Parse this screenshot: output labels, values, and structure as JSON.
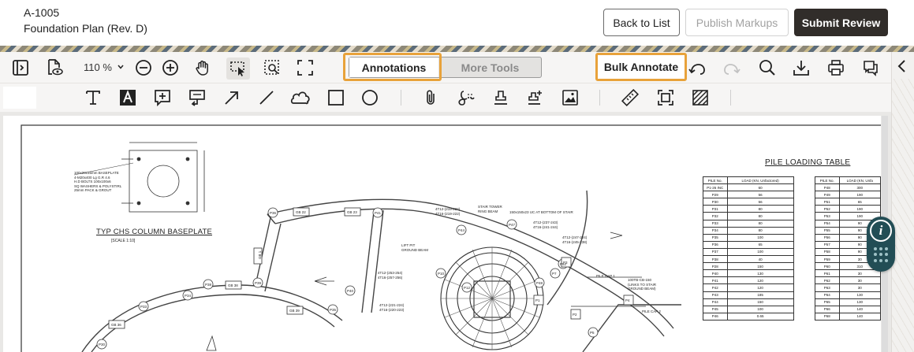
{
  "header": {
    "doc_id": "A-1005",
    "doc_title": "Foundation Plan (Rev. D)",
    "back_label": "Back to List",
    "publish_label": "Publish Markups",
    "submit_label": "Submit Review"
  },
  "toolbar": {
    "zoom": "110 %",
    "tab_annotations": "Annotations",
    "tab_more_tools": "More Tools",
    "bulk_annotate": "Bulk Annotate",
    "icons_row1": [
      "sidebar-toggle-icon",
      "document-eye-icon",
      "zoom-dropdown-chevron-icon",
      "zoom-out-icon",
      "zoom-in-icon",
      "pan-hand-icon",
      "select-area-icon",
      "zoom-area-icon",
      "fullscreen-icon",
      "undo-icon",
      "redo-icon",
      "search-icon",
      "download-icon",
      "print-icon",
      "comments-icon",
      "collapse-panel-icon"
    ],
    "icons_row2": [
      "text-icon",
      "text-box-icon",
      "note-icon",
      "callout-icon",
      "arrow-icon",
      "line-icon",
      "cloud-icon",
      "rectangle-icon",
      "ellipse-icon",
      "attachment-icon",
      "signature-icon",
      "stamp-icon",
      "custom-stamp-icon",
      "image-icon",
      "measure-icon",
      "crop-icon",
      "hatch-icon"
    ]
  },
  "drawing": {
    "plan_title": "TYP CHS COLUMN BASEPLATE",
    "plan_scale": "[SCALE 1:10]",
    "table_title": "PILE LOADING TABLE",
    "table_header": [
      "PILE No.",
      "LOAD (KN, Unfactored)",
      "PILE No.",
      "LOAD (KN, Unfa"
    ],
    "table_rows": [
      [
        "P1-26 INC",
        "60",
        "P48",
        "300"
      ],
      [
        "P29",
        "56",
        "P49",
        "190"
      ],
      [
        "P30",
        "56",
        "P51",
        "65"
      ],
      [
        "P31",
        "80",
        "P52",
        "190"
      ],
      [
        "P32",
        "80",
        "P53",
        "190"
      ],
      [
        "P33",
        "80",
        "P54",
        "90"
      ],
      [
        "P34",
        "80",
        "P55",
        "90"
      ],
      [
        "P35",
        "100",
        "P56",
        "90"
      ],
      [
        "P36",
        "65",
        "P57",
        "90"
      ],
      [
        "P37",
        "100",
        "P58",
        "90"
      ],
      [
        "P38",
        "40",
        "P59",
        "30"
      ],
      [
        "P28",
        "150",
        "P60",
        "310"
      ],
      [
        "P40",
        "130",
        "P61",
        "30"
      ],
      [
        "P41",
        "120",
        "P62",
        "30"
      ],
      [
        "P42",
        "120",
        "P63",
        "30"
      ],
      [
        "P43",
        "185",
        "P64",
        "130"
      ],
      [
        "P44",
        "150",
        "P65",
        "130"
      ],
      [
        "P45",
        "100",
        "P66",
        "140"
      ],
      [
        "P46",
        "0.65",
        "P68",
        "140"
      ]
    ],
    "notes": {
      "baseplate": "100x20x15mm BASEPLATE\n4-M20x400 Lg G.R 4.6\nH.D BOLTS 100x100x6\nSQ WASHERS & POLYSTIRL\n25mm PACK & GROUT",
      "stair": "STAIR TOWER\nRING BEAM",
      "uc": "150x150x23 UC AT BOTTOM OF STAIR",
      "bars1": "4T12-(219-222)\n4T16-(219-222)",
      "bars2": "4T12-(237-243)\n4T16-(241-244)",
      "bars3": "4T12-(247-224)\n4T16-(245-238)",
      "lift": "LIFT PIT\nGROUND BEAM",
      "bars4": "4T12-(253-254)\n4T16-(257-256)",
      "bars5": "4T12-(221-224)\n4T16-(220-223)",
      "pile_cap": "PILE CAP 1",
      "pile_cap2": "PILE CAP 2",
      "cols": "100TB-CB-150\n(LINKS TO STAIR\nGROUND BEAM)"
    },
    "pile_markers": [
      "P36",
      "GB 22",
      "GB 23",
      "P41",
      "P40",
      "P44",
      "P47",
      "GB 1",
      "P39",
      "GB 38",
      "P38",
      "P34",
      "P33",
      "P32",
      "GB 36",
      "P30",
      "P35",
      "GB 39",
      "P10",
      "P48",
      "P1",
      "P2",
      "P3",
      "P5",
      "P52",
      "P7",
      "P4",
      "P12",
      "P14",
      "P15"
    ]
  },
  "colors": {
    "accent_highlight": "#e8a23a",
    "submit_bg": "#312d2a",
    "info_panel": "#224d55"
  }
}
